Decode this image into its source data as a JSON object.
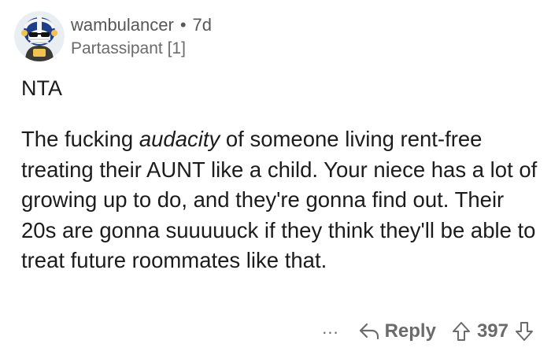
{
  "comment": {
    "author": "wambulancer",
    "separator": "•",
    "age": "7d",
    "flair": "Partassipant [1]",
    "verdict": "NTA",
    "body": {
      "part1": "The fucking ",
      "emphasis": "audacity",
      "part2": " of someone living rent-free treating their AUNT like a child. Your niece has a lot of growing up to do, and they're gonna find out. Their 20s are gonna suuuuuck if they think they'll be able to treat future roommates like that."
    },
    "actions": {
      "more_label": "...",
      "reply_label": "Reply",
      "score": "397"
    }
  },
  "colors": {
    "text": "#1c1c1c",
    "meta": "#575757",
    "actions": "#6b6b6b",
    "avatar_bg": "#1d3f8a"
  },
  "icons": {
    "avatar": "snoo-avatar-helmet",
    "reply": "reply-arrow-icon",
    "upvote": "upvote-arrow-icon",
    "downvote": "downvote-arrow-icon"
  }
}
